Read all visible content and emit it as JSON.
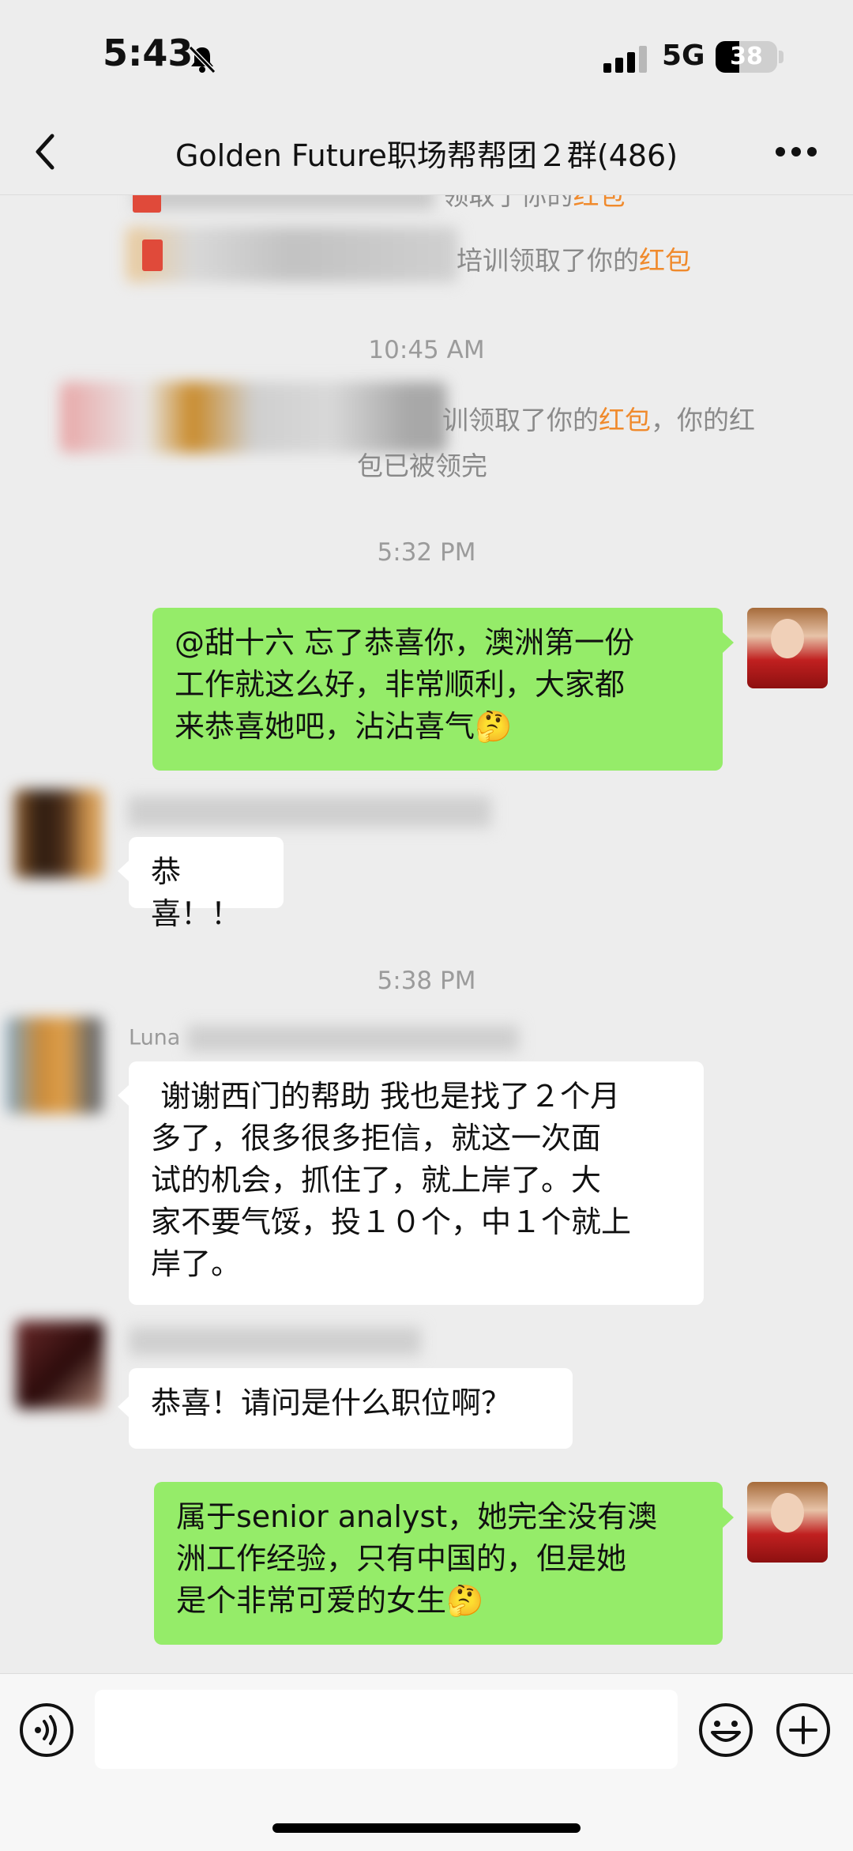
{
  "status_bar": {
    "time": "5:43",
    "network": "5G",
    "battery": "38",
    "battery_level": 0.38
  },
  "header": {
    "title": "Golden Future职场帮帮团２群(486)"
  },
  "system_notices": {
    "top_partial": {
      "text": "领取了你的",
      "red": "红包"
    },
    "notice_1": {
      "text": "培训领取了你的",
      "red": "红包"
    },
    "notice_2": {
      "line1_text": "训领取了你的",
      "red": "红包",
      "line1_tail": "，你的红",
      "line2": "包已被领完"
    }
  },
  "timestamps": {
    "t1": "10:45 AM",
    "t2": "5:32 PM",
    "t3": "5:38 PM"
  },
  "messages": {
    "m1": {
      "lines": [
        "@甜十六 忘了恭喜你，澳洲第一份",
        "工作就这么好，非常顺利，大家都",
        "来恭喜她吧，沾沾喜气🤔"
      ]
    },
    "m2": {
      "sender": "y",
      "lines": [
        "恭喜！！"
      ]
    },
    "m3": {
      "sender": "Luna",
      "lines": [
        " 谢谢西门的帮助 我也是找了２个月",
        "多了，很多很多拒信，就这一次面",
        "试的机会，抓住了，就上岸了。大",
        "家不要气馁，投１０个，中１个就上",
        "岸了。"
      ]
    },
    "m4": {
      "sender": "",
      "lines": [
        "恭喜！请问是什么职位啊？"
      ]
    },
    "m5": {
      "lines": [
        "属于senior analyst，她完全没有澳",
        "洲工作经验，只有中国的，但是她",
        "是个非常可爱的女生🤔"
      ]
    }
  },
  "icons": {
    "back": "chevron-left-icon",
    "more": "more-dots-icon",
    "voice": "voice-icon",
    "emoji": "emoji-icon",
    "plus": "plus-icon",
    "bell": "bell-slash-icon",
    "signal": "signal-icon"
  },
  "colors": {
    "my_bubble": "#95ec69",
    "other_bubble": "#ffffff",
    "red_packet": "#f08a2c",
    "background": "#ededed"
  }
}
